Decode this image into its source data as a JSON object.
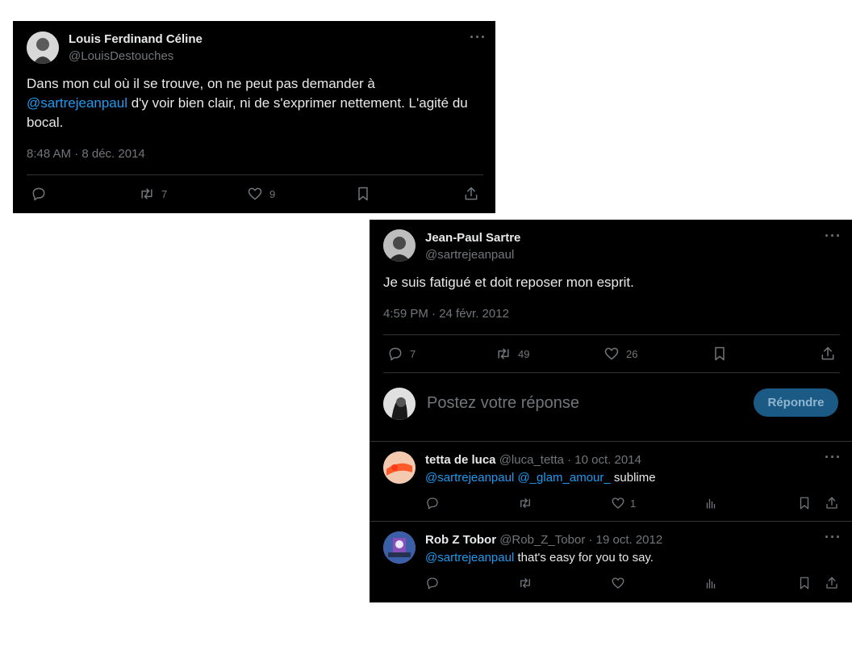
{
  "tweet1": {
    "author_name": "Louis Ferdinand Céline",
    "author_handle": "@LouisDestouches",
    "text_line1": "Dans mon cul où il se trouve, on ne peut pas demander à",
    "mention": "@sartrejeanpaul",
    "text_after_mention": " d'y voir bien clair, ni de s'exprimer nettement. L'agité du",
    "text_line3": "bocal.",
    "timestamp": "8:48 AM · 8 déc. 2014",
    "retweets": "7",
    "likes": "9",
    "more_icon": "more-icon"
  },
  "tweet2": {
    "author_name": "Jean-Paul Sartre",
    "author_handle": "@sartrejeanpaul",
    "text": "Je suis fatigué et doit reposer mon esprit.",
    "timestamp": "4:59 PM · 24 févr. 2012",
    "replies": "7",
    "retweets": "49",
    "likes": "26"
  },
  "reply_box": {
    "placeholder": "Postez votre réponse",
    "button_label": "Répondre"
  },
  "replies": [
    {
      "name": "tetta de luca",
      "handle_date": " @luca_tetta · 10 oct. 2014",
      "mentions": "@sartrejeanpaul @_glam_amour_",
      "text": " sublime",
      "likes": "1"
    },
    {
      "name": "Rob Z Tobor",
      "handle_date": " @Rob_Z_Tobor · 19 oct. 2012",
      "mentions": "@sartrejeanpaul",
      "text": " that's easy for you to say."
    }
  ],
  "colors": {
    "background": "#000000",
    "text": "#e7e9ea",
    "secondary": "#71767b",
    "accent": "#1d9bf0",
    "separator": "#2f3336"
  }
}
